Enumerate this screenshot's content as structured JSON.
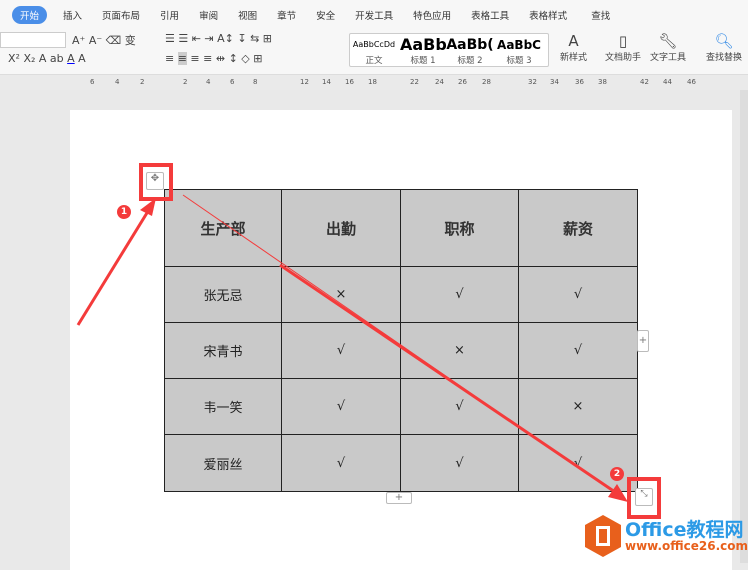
{
  "menu": [
    "开始",
    "插入",
    "页面布局",
    "引用",
    "审阅",
    "视图",
    "章节",
    "安全",
    "开发工具",
    "特色应用",
    "表格工具",
    "表格样式",
    "查找"
  ],
  "styles": [
    {
      "preview": "AaBbCcDd",
      "label": "正文"
    },
    {
      "preview": "AaBb",
      "label": "标题 1"
    },
    {
      "preview": "AaBb(",
      "label": "标题 2"
    },
    {
      "preview": "AaBbC",
      "label": "标题 3"
    }
  ],
  "tools": {
    "new_style": "新样式",
    "doc_helper": "文档助手",
    "text_tools": "文字工具",
    "find_replace": "查找替换"
  },
  "ruler": [
    "6",
    "4",
    "2",
    "2",
    "4",
    "6",
    "8",
    "12",
    "14",
    "16",
    "18",
    "22",
    "24",
    "26",
    "28",
    "32",
    "34",
    "36",
    "38",
    "42",
    "44",
    "46"
  ],
  "table": {
    "headers": [
      "生产部",
      "出勤",
      "职称",
      "薪资"
    ],
    "rows": [
      [
        "张无忌",
        "×",
        "√",
        "√"
      ],
      [
        "宋青书",
        "√",
        "×",
        "√"
      ],
      [
        "韦一笑",
        "√",
        "√",
        "×"
      ],
      [
        "爱丽丝",
        "√",
        "√",
        "√"
      ]
    ]
  },
  "badges": [
    "1",
    "2"
  ],
  "watermark": {
    "title": "Office教程网",
    "url": "www.office26.com"
  }
}
